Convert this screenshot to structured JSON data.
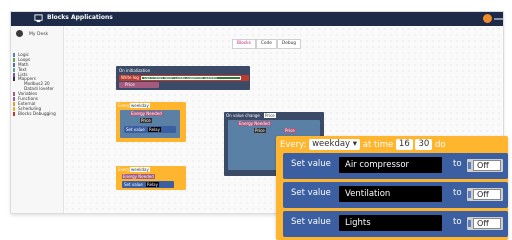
{
  "app": {
    "title": "Blocks Applications"
  },
  "sidebar": {
    "user": "My Desk",
    "categories": [
      {
        "label": "Logic",
        "color": "#5b80a5"
      },
      {
        "label": "Loops",
        "color": "#5ba55b"
      },
      {
        "label": "Math",
        "color": "#5b67a5"
      },
      {
        "label": "Text",
        "color": "#5ba58c"
      },
      {
        "label": "Lists",
        "color": "#745ba5"
      },
      {
        "label": "Mappers",
        "color": "#333333"
      },
      {
        "label": "Modbus2 20",
        "color": "transparent"
      },
      {
        "label": "Datadi loveter",
        "color": "transparent"
      },
      {
        "label": "Variables",
        "color": "#a55b80"
      },
      {
        "label": "Functions",
        "color": "#9a5ba5"
      },
      {
        "label": "External",
        "color": "#d8a03a"
      },
      {
        "label": "Scheduling",
        "color": "#e0b030"
      },
      {
        "label": "Blocks Debugging",
        "color": "#c0392b"
      }
    ]
  },
  "tabs": [
    "Blocks",
    "Code",
    "Debug"
  ],
  "canvas_blocks": {
    "init_label": "On initialization",
    "log_label": "Write log",
    "log_text": "Use Energy when Cheap Algorithm Started",
    "value_change": "On value change",
    "price": "Price",
    "every": "Every:",
    "weekday": "weekday",
    "set_value": "Set value",
    "relay": "Relay",
    "energy_needed": "Energy Needed",
    "at_time": "at time"
  },
  "zoomed": {
    "every": "Every:",
    "day": "weekday",
    "at_time": "at time",
    "hour": "16",
    "minute": "30",
    "do": "do",
    "rows": [
      {
        "label": "Set value",
        "device": "Air compressor",
        "to": "to",
        "state": "Off"
      },
      {
        "label": "Set value",
        "device": "Ventilation",
        "to": "to",
        "state": "Off"
      },
      {
        "label": "Set value",
        "device": "Lights",
        "to": "to",
        "state": "Off"
      }
    ]
  },
  "colors": {
    "titlebar": "#1d2b48",
    "accent": "#f28c28",
    "schedule": "#ffb52e",
    "action": "#3b5fa0"
  }
}
